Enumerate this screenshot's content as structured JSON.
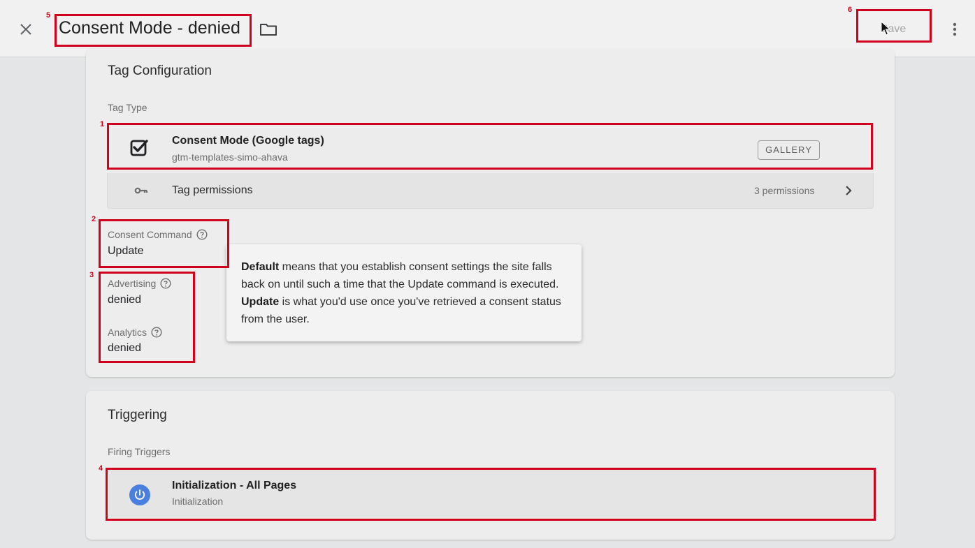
{
  "header": {
    "title": "Consent Mode - denied",
    "save_label": "Save"
  },
  "config": {
    "card_title": "Tag Configuration",
    "tag_type_label": "Tag Type",
    "tag_type": {
      "name": "Consent Mode (Google tags)",
      "source": "gtm-templates-simo-ahava",
      "badge": "GALLERY"
    },
    "permissions": {
      "label": "Tag permissions",
      "count": "3 permissions"
    },
    "fields": [
      {
        "label": "Consent Command",
        "value": "Update"
      },
      {
        "label": "Advertising",
        "value": "denied"
      },
      {
        "label": "Analytics",
        "value": "denied"
      }
    ],
    "tooltip": {
      "default_word": "Default",
      "text_1": " means that you establish consent settings the site falls back on until such a time that the Update command is executed. ",
      "update_word": "Update",
      "text_2": " is what you'd use once you've retrieved a consent status from the user."
    }
  },
  "triggering": {
    "card_title": "Triggering",
    "firing_label": "Firing Triggers",
    "trigger": {
      "name": "Initialization - All Pages",
      "type": "Initialization"
    }
  },
  "annotations": [
    "1",
    "2",
    "3",
    "4",
    "5",
    "6"
  ],
  "colors": {
    "highlight": "#d0021b",
    "trigger_icon": "#4a7fe0"
  },
  "icons": [
    "close-icon",
    "folder-icon",
    "cursor-icon",
    "more-vert-icon",
    "checkbox-icon",
    "key-icon",
    "chevron-right-icon",
    "help-icon",
    "power-icon"
  ]
}
